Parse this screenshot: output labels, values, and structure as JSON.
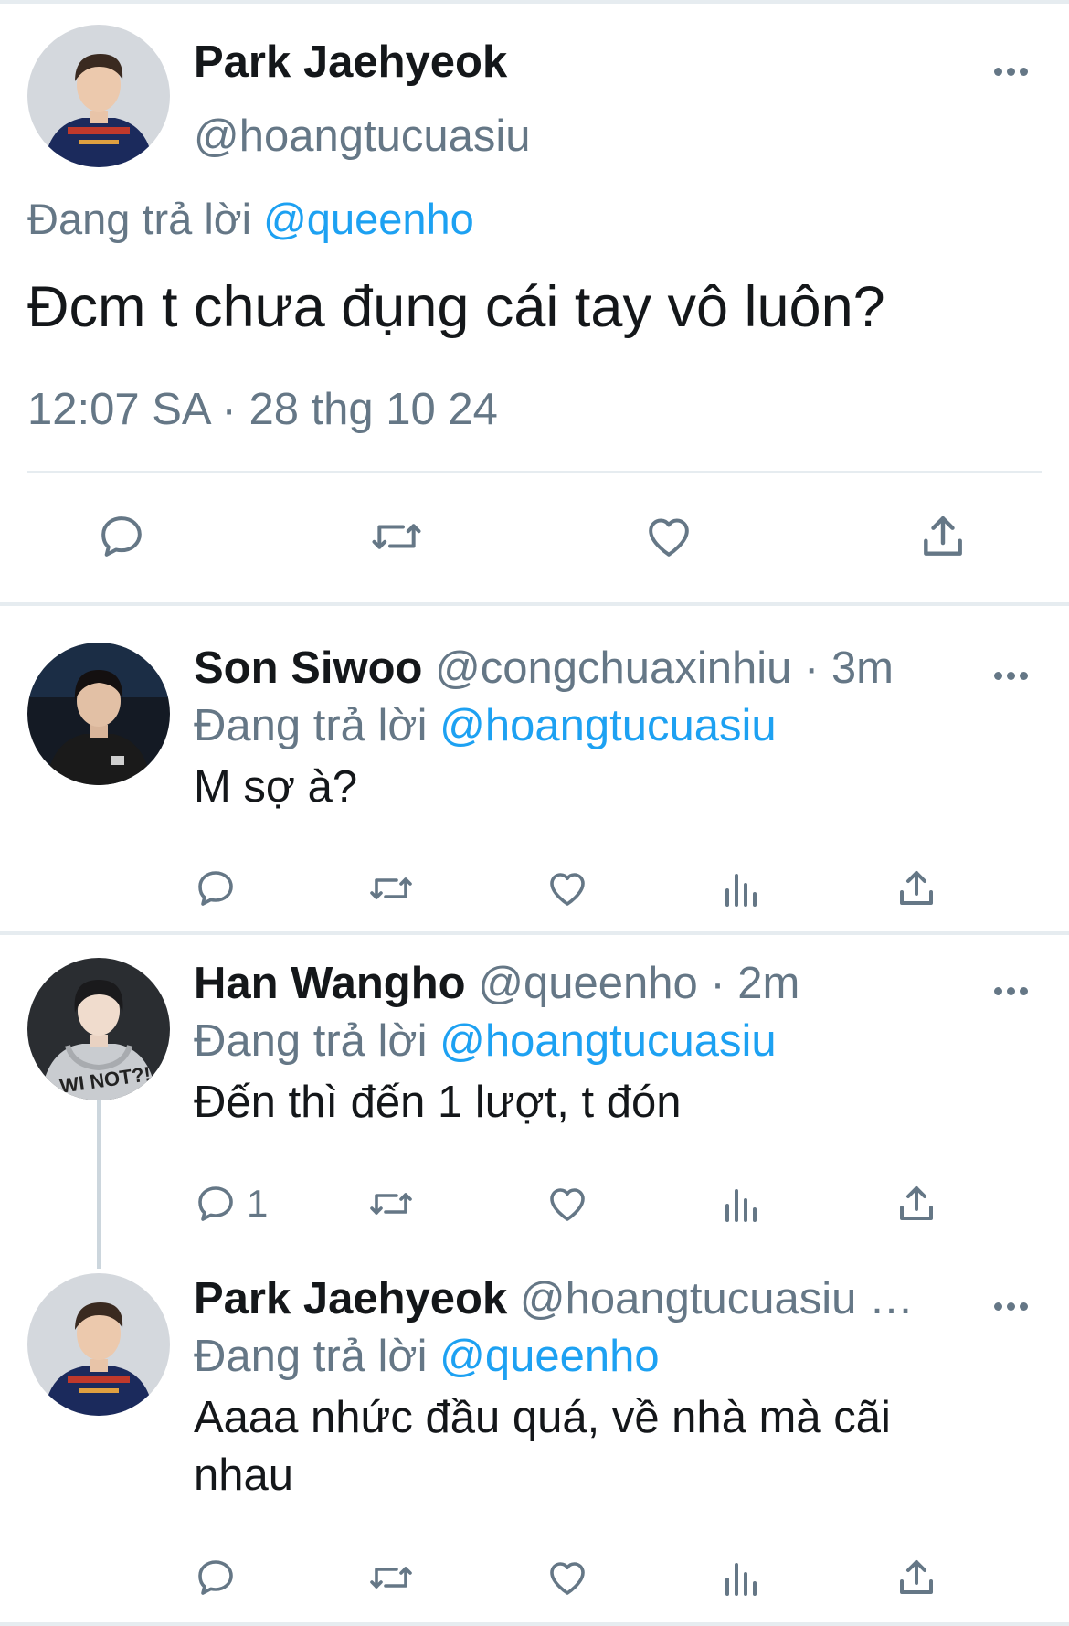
{
  "main_tweet": {
    "author_name": "Park Jaehyeok",
    "handle": "@hoangtucuasiu",
    "reply_prefix": "Đang trả lời",
    "reply_to": "@queenho",
    "text": "Đcm t chưa đụng cái tay vô luôn?",
    "timestamp": "12:07 SA · 28 thg 10 24",
    "actions": [
      "reply-icon",
      "retweet-icon",
      "like-icon",
      "share-icon"
    ]
  },
  "replies": [
    {
      "author_name": "Son Siwoo",
      "meta": "@congchuaxinhiu · 3m",
      "reply_prefix": "Đang trả lời",
      "reply_to": "@hoangtucuasiu",
      "text": "M sợ à?",
      "reply_count": ""
    },
    {
      "author_name": "Han Wangho",
      "meta": "@queenho · 2m",
      "reply_prefix": "Đang trả lời",
      "reply_to": "@hoangtucuasiu",
      "text": "Đến thì đến 1 lượt, t đón",
      "reply_count": "1"
    },
    {
      "author_name": "Park Jaehyeok",
      "meta": "@hoangtucuasiu …",
      "reply_prefix": "Đang trả lời",
      "reply_to": "@queenho",
      "text": "Aaaa nhức đầu quá, về nhà mà cãi nhau",
      "reply_count": ""
    }
  ],
  "colors": {
    "text": "#14171a",
    "secondary": "#657786",
    "mention": "#1da1f2",
    "divider": "#e6ecf0",
    "jersey": "#1b2a5c"
  }
}
